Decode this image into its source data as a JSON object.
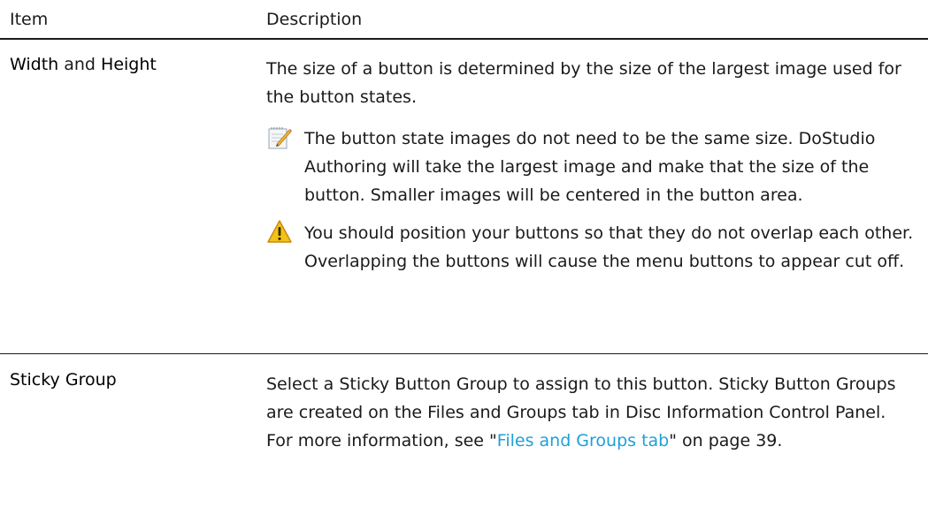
{
  "header": {
    "item_label": "Item",
    "description_label": "Description"
  },
  "rows": [
    {
      "item_part1": "Width",
      "item_and": " and ",
      "item_part2": "Height",
      "description": "The size of a button is determined by the size of the largest image used for the button states.",
      "note": {
        "icon": "note-pencil-icon",
        "text": "The button state images do not need to be the same size. DoStudio Authoring will take the largest image and make that the size of the button. Smaller images will be centered in the button area."
      },
      "warning": {
        "icon": "warning-triangle-icon",
        "text": "You should position your buttons so that they do not overlap each other. Overlapping the buttons will cause the menu buttons to appear cut off."
      }
    },
    {
      "item": "Sticky Group",
      "description_before_link": "Select a Sticky Button Group to assign to this button. Sticky Button Groups are created on the Files and Groups tab in Disc Information Control Panel. For more information, see \"",
      "link_text": "Files and Groups tab",
      "description_after_link": "\" on page 39."
    }
  ],
  "colors": {
    "text": "#1a1a1a",
    "link": "#1ea0d8",
    "warning_fill": "#f2c21b",
    "warning_border": "#c98a0c"
  }
}
